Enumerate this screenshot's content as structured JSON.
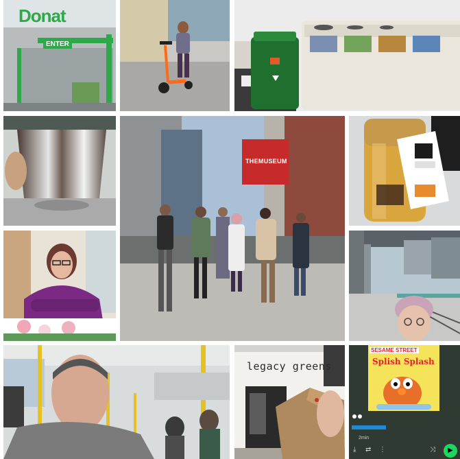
{
  "collage": {
    "tiles": [
      {
        "id": "donation-store",
        "sign": "Donat",
        "entrance": "ENTER"
      },
      {
        "id": "scooter-rider"
      },
      {
        "id": "recycling-bins"
      },
      {
        "id": "chrome-mug"
      },
      {
        "id": "museum-group",
        "sign": "THEMUSEUM"
      },
      {
        "id": "jar-drink"
      },
      {
        "id": "woman-purple-hoodie"
      },
      {
        "id": "transit-selfie"
      },
      {
        "id": "bus-selfie"
      },
      {
        "id": "legacy-greens",
        "sign": "legacy greens"
      },
      {
        "id": "music-app",
        "album_brand": "SESAME STREET",
        "album_title": "Splish Splash",
        "duration": "2min"
      }
    ]
  },
  "colors": {
    "store_green": "#2fa84a",
    "museum_red": "#c62a2a",
    "hoodie_purple": "#7a2a82",
    "play_green": "#1ed760"
  },
  "icons": [
    "play-icon",
    "shuffle-icon",
    "download-icon",
    "more-icon"
  ]
}
